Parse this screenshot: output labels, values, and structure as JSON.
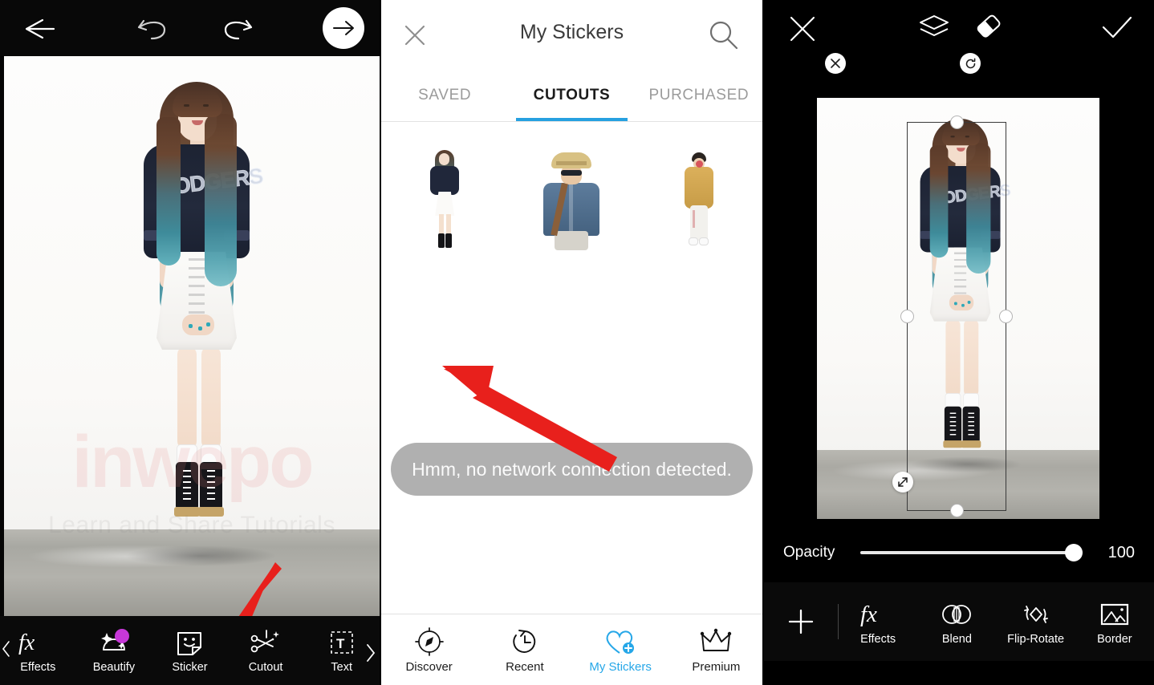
{
  "editor": {
    "topbar": {
      "back_icon": "arrow-left-icon",
      "undo_icon": "undo-icon",
      "redo_icon": "redo-icon",
      "next_icon": "arrow-right-icon"
    },
    "watermark": {
      "main": "inwepo",
      "sub": "Learn and Share Tutorials"
    },
    "tools": [
      {
        "label": "Effects",
        "icon": "fx-icon",
        "badge": false
      },
      {
        "label": "Beautify",
        "icon": "face-icon",
        "badge": true
      },
      {
        "label": "Sticker",
        "icon": "sticker-icon",
        "badge": false
      },
      {
        "label": "Cutout",
        "icon": "scissors-icon",
        "badge": false
      },
      {
        "label": "Text",
        "icon": "text-box-icon",
        "badge": false
      }
    ],
    "more_chevron": "›"
  },
  "stickers": {
    "title": "My Stickers",
    "close_icon": "close-icon",
    "search_icon": "search-icon",
    "tabs": [
      {
        "label": "SAVED",
        "active": false
      },
      {
        "label": "CUTOUTS",
        "active": true
      },
      {
        "label": "PURCHASED",
        "active": false
      }
    ],
    "active_tab_color": "#26a0e0",
    "items": [
      {
        "name": "cutout-girl-navy-jersey"
      },
      {
        "name": "cutout-man-straw-hat"
      },
      {
        "name": "cutout-man-yellow-sweater"
      }
    ],
    "toast": "Hmm, no network connection detected.",
    "bottom_nav": [
      {
        "label": "Discover",
        "icon": "compass-icon",
        "active": false
      },
      {
        "label": "Recent",
        "icon": "clock-back-icon",
        "active": false
      },
      {
        "label": "My Stickers",
        "icon": "heart-plus-icon",
        "active": true
      },
      {
        "label": "Premium",
        "icon": "crown-icon",
        "active": false
      }
    ],
    "active_nav_color": "#26a7e8"
  },
  "canvas": {
    "topbar": {
      "close_icon": "close-icon",
      "layers_icon": "layers-icon",
      "eraser_icon": "eraser-icon",
      "apply_icon": "check-icon"
    },
    "selection": {
      "delete_icon": "close-icon",
      "rotate_icon": "rotate-icon",
      "resize_icon": "resize-diagonal-icon"
    },
    "opacity": {
      "label": "Opacity",
      "value": "100",
      "percent": 100
    },
    "add_icon": "plus-icon",
    "tools": [
      {
        "label": "Effects",
        "icon": "fx-icon"
      },
      {
        "label": "Blend",
        "icon": "blend-icon"
      },
      {
        "label": "Flip-Rotate",
        "icon": "flip-rotate-icon"
      },
      {
        "label": "Border",
        "icon": "image-border-icon"
      }
    ]
  },
  "annotations": {
    "arrow_color": "#e8201c",
    "arrows": [
      {
        "name": "pointer-to-sticker-tool"
      },
      {
        "name": "pointer-to-cutout-item"
      }
    ]
  }
}
